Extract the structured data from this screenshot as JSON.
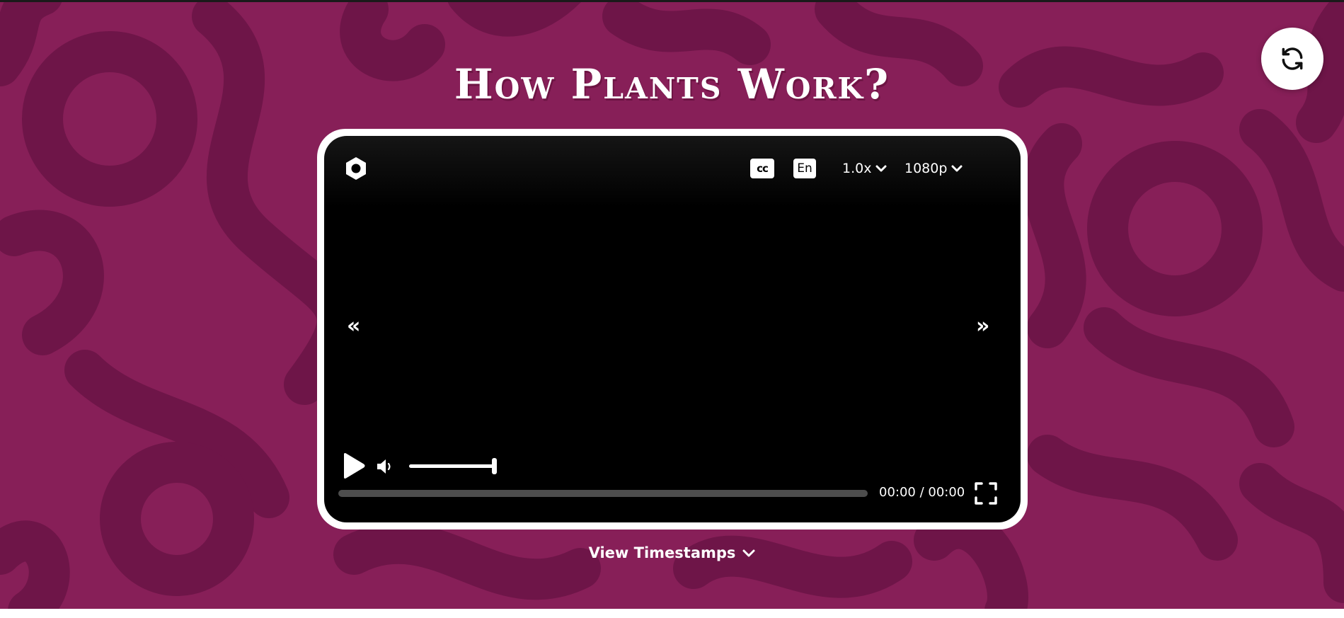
{
  "page": {
    "title": "How Plants Work?",
    "background_color": "#871f58",
    "pattern_color": "#6e1548"
  },
  "refresh_button": {
    "icon": "refresh-icon"
  },
  "player": {
    "logo_icon": "hexagon-logo-icon",
    "captions_label": "cc",
    "language_label": "En",
    "speed_label": "1.0x",
    "quality_label": "1080p",
    "prev_label": "«",
    "next_label": "»",
    "time_display": "00:00 / 00:00",
    "volume_level": 1.0,
    "progress": 0.0
  },
  "timestamps": {
    "label": "View Timestamps"
  }
}
